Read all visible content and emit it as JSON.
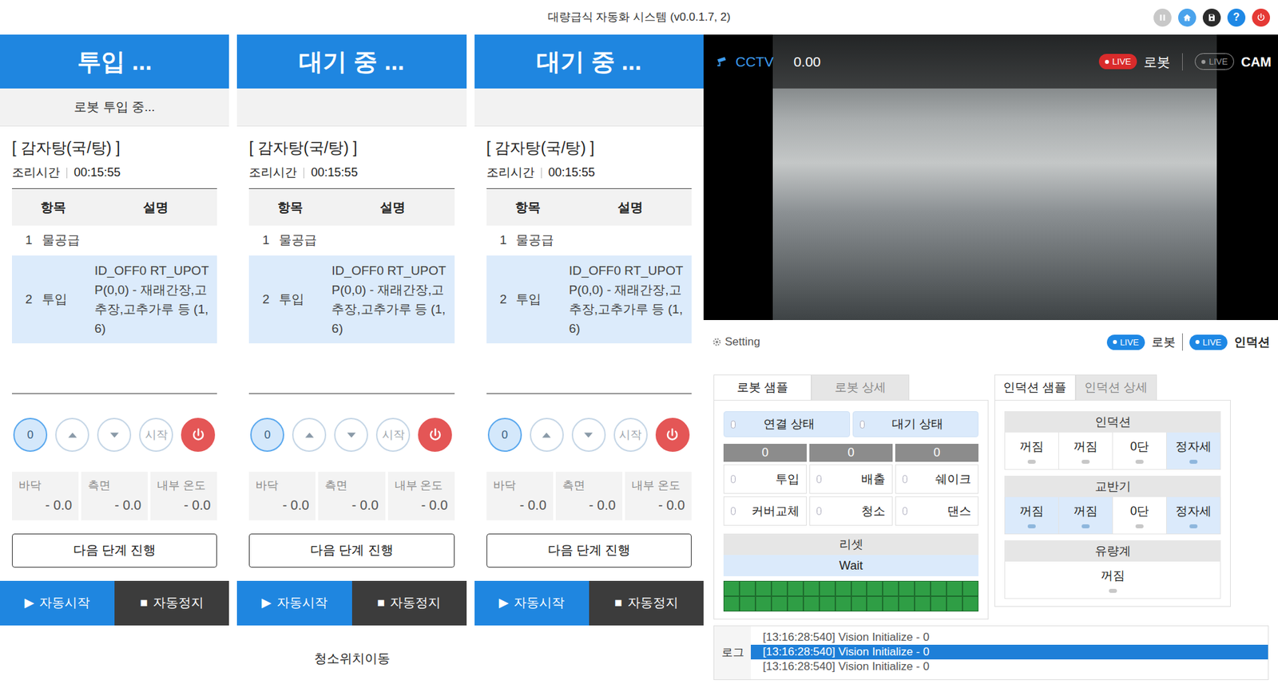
{
  "window": {
    "title": "대량급식 자동화 시스템 (v0.0.1.7, 2)"
  },
  "toolbar": [
    {
      "kind": "pause",
      "color": "#c8c8c8"
    },
    {
      "kind": "home",
      "color": "#4aa3ec"
    },
    {
      "kind": "save",
      "color": "#2b2b2b"
    },
    {
      "kind": "help",
      "color": "#1e88e5",
      "glyph": "?"
    },
    {
      "kind": "power",
      "color": "#e53935"
    }
  ],
  "stations": [
    {
      "status": "투입 ...",
      "substatus": "로봇 투입 중...",
      "recipe": "[ 감자탕(국/탕) ]",
      "cook_label": "조리시간",
      "cook_time": "00:15:55",
      "columns": [
        "항목",
        "설명"
      ],
      "rows": [
        {
          "no": "1",
          "item": "물공급",
          "selected": false
        },
        {
          "no": "2",
          "item": "투입",
          "desc": "ID_OFF0 RT_UPOTP(0,0) - 재래간장,고추장,고추가루 등 (1,6)",
          "selected": true
        }
      ],
      "counter": "0",
      "start": "시작",
      "sensors": [
        {
          "label": "바닥",
          "value": "- 0.0"
        },
        {
          "label": "측면",
          "value": "- 0.0"
        },
        {
          "label": "내부 온도",
          "value": "- 0.0"
        }
      ],
      "next": "다음 단계 진행",
      "auto_start": {
        "icon": "▶",
        "label": "자동시작"
      },
      "auto_stop": {
        "icon": "■",
        "label": "자동정지"
      }
    },
    {
      "status": "대기 중 ...",
      "recipe": "[ 감자탕(국/탕) ]",
      "cook_label": "조리시간",
      "cook_time": "00:15:55",
      "columns": [
        "항목",
        "설명"
      ],
      "rows": [
        {
          "no": "1",
          "item": "물공급",
          "selected": false
        },
        {
          "no": "2",
          "item": "투입",
          "desc": "ID_OFF0 RT_UPOTP(0,0) - 재래간장,고추장,고추가루 등 (1,6)",
          "selected": true
        }
      ],
      "counter": "0",
      "start": "시작",
      "sensors": [
        {
          "label": "바닥",
          "value": "- 0.0"
        },
        {
          "label": "측면",
          "value": "- 0.0"
        },
        {
          "label": "내부 온도",
          "value": "- 0.0"
        }
      ],
      "next": "다음 단계 진행",
      "auto_start": {
        "icon": "▶",
        "label": "자동시작"
      },
      "auto_stop": {
        "icon": "■",
        "label": "자동정지"
      }
    },
    {
      "status": "대기 중 ...",
      "recipe": "[ 감자탕(국/탕) ]",
      "cook_label": "조리시간",
      "cook_time": "00:15:55",
      "columns": [
        "항목",
        "설명"
      ],
      "rows": [
        {
          "no": "1",
          "item": "물공급",
          "selected": false
        },
        {
          "no": "2",
          "item": "투입",
          "desc": "ID_OFF0 RT_UPOTP(0,0) - 재래간장,고추장,고추가루 등 (1,6)",
          "selected": true
        }
      ],
      "counter": "0",
      "start": "시작",
      "sensors": [
        {
          "label": "바닥",
          "value": "- 0.0"
        },
        {
          "label": "측면",
          "value": "- 0.0"
        },
        {
          "label": "내부 온도",
          "value": "- 0.0"
        }
      ],
      "next": "다음 단계 진행",
      "auto_start": {
        "icon": "▶",
        "label": "자동시작"
      },
      "auto_stop": {
        "icon": "■",
        "label": "자동정지"
      }
    }
  ],
  "footer": "청소위치이동",
  "cctv": {
    "label": "CCTV",
    "value": "0.00",
    "badges": [
      {
        "label": "LIVE",
        "text": "로봇",
        "on": true
      },
      {
        "label": "LIVE",
        "text": "CAM",
        "on": false
      }
    ]
  },
  "setting": {
    "label": "Setting",
    "badges": [
      {
        "label": "LIVE",
        "text": "로봇",
        "on": true
      },
      {
        "label": "LIVE",
        "text": "인덕션",
        "on": true
      }
    ]
  },
  "robot_panel": {
    "tabs": [
      {
        "label": "로봇 샘플",
        "selected": true
      },
      {
        "label": "로봇 상세",
        "selected": false
      }
    ],
    "status": [
      {
        "label": "연결 상태",
        "on": true
      },
      {
        "label": "대기 상태",
        "on": true
      }
    ],
    "counters": [
      "0",
      "0",
      "0"
    ],
    "actions": [
      {
        "label": "투입",
        "on": false
      },
      {
        "label": "배출",
        "on": false
      },
      {
        "label": "쉐이크",
        "on": false
      },
      {
        "label": "커버교체",
        "on": false
      },
      {
        "label": "청소",
        "on": false
      },
      {
        "label": "댄스",
        "on": false
      }
    ],
    "reset": {
      "label": "리셋",
      "state": "Wait"
    },
    "leds": [
      {
        "on": true
      },
      {
        "on": true
      },
      {
        "on": true
      },
      {
        "on": true
      },
      {
        "on": true
      },
      {
        "on": true
      },
      {
        "on": true
      },
      {
        "on": true
      },
      {
        "on": true
      },
      {
        "on": true
      },
      {
        "on": true
      },
      {
        "on": true
      },
      {
        "on": true
      },
      {
        "on": true
      },
      {
        "on": true
      },
      {
        "on": true
      },
      {
        "on": true
      },
      {
        "on": true
      },
      {
        "on": true
      },
      {
        "on": true
      },
      {
        "on": true
      },
      {
        "on": true
      },
      {
        "on": true
      },
      {
        "on": true
      },
      {
        "on": true
      },
      {
        "on": true
      },
      {
        "on": true
      },
      {
        "on": true
      },
      {
        "on": true
      },
      {
        "on": true
      },
      {
        "on": true
      },
      {
        "on": true
      }
    ]
  },
  "induction_panel": {
    "tabs": [
      {
        "label": "인덕션 샘플",
        "selected": true
      },
      {
        "label": "인덕션 상세",
        "selected": false
      }
    ],
    "groups": [
      {
        "title": "인덕션",
        "items": [
          {
            "label": "꺼짐",
            "on": false
          },
          {
            "label": "꺼짐",
            "on": false
          },
          {
            "label": "0단",
            "on": false
          },
          {
            "label": "정자세",
            "on": true
          }
        ]
      },
      {
        "title": "교반기",
        "items": [
          {
            "label": "꺼짐",
            "on": true
          },
          {
            "label": "꺼짐",
            "on": true
          },
          {
            "label": "0단",
            "on": false
          },
          {
            "label": "정자세",
            "on": true
          }
        ]
      },
      {
        "title": "유량계",
        "items": [
          {
            "label": "꺼짐",
            "on": false
          }
        ]
      }
    ]
  },
  "log": {
    "label": "로그",
    "lines": [
      {
        "text": "[13:16:28:540] Vision Initialize - 0",
        "selected": false
      },
      {
        "text": "[13:16:28:540] Vision Initialize - 0",
        "selected": true
      },
      {
        "text": "[13:16:28:540] Vision Initialize - 0",
        "selected": false
      }
    ]
  }
}
